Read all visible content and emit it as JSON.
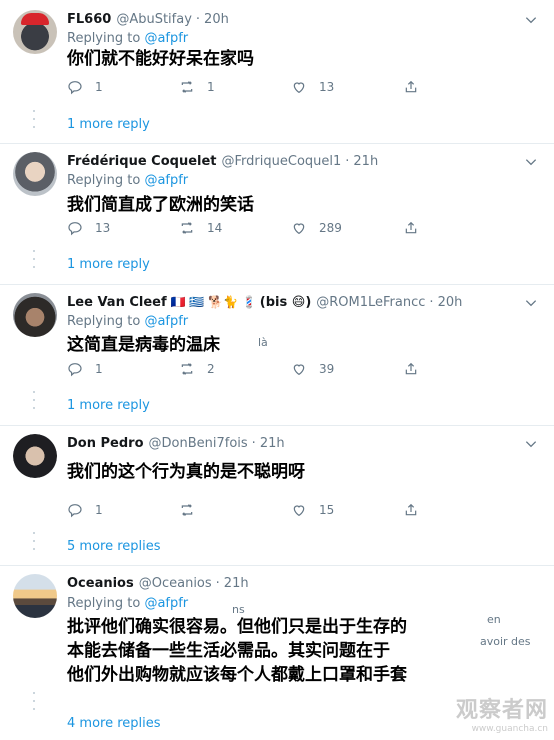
{
  "tweets": [
    {
      "name": "FL660",
      "handle": "@AbuStifay",
      "time": "20h",
      "replying_prefix": "Replying to",
      "replying_to": "@afpfr",
      "text_lines": [
        "你们就不能好好呆在家吗"
      ],
      "ghost": [],
      "reply_count": "1",
      "retweet_count": "1",
      "like_count": "13",
      "more_replies": "1 more reply"
    },
    {
      "name": "Frédérique Coquelet",
      "handle": "@FrdriqueCoquel1",
      "time": "21h",
      "replying_prefix": "Replying to",
      "replying_to": "@afpfr",
      "text_lines": [
        "我们简直成了欧洲的笑话"
      ],
      "ghost": [],
      "reply_count": "13",
      "retweet_count": "14",
      "like_count": "289",
      "more_replies": "1 more reply"
    },
    {
      "name": "Lee Van Cleef",
      "name_emojis": "🇫🇷 🇬🇷 🐕🐈 💈",
      "name_suffix": "(bis 😄)",
      "handle": "@ROM1LeFrancc",
      "time": "20h",
      "replying_prefix": "Replying to",
      "replying_to": "@afpfr",
      "text_lines": [
        "这简直是病毒的温床"
      ],
      "ghost": [
        "là"
      ],
      "reply_count": "1",
      "retweet_count": "2",
      "like_count": "39",
      "more_replies": "1 more reply"
    },
    {
      "name": "Don Pedro",
      "handle": "@DonBeni7fois",
      "time": "21h",
      "replying_prefix": "",
      "replying_to": "",
      "text_lines": [
        "我们的这个行为真的是不聪明呀"
      ],
      "ghost": [],
      "reply_count": "1",
      "retweet_count": "",
      "like_count": "15",
      "more_replies": "5 more replies"
    },
    {
      "name": "Oceanios",
      "handle": "@Oceanios",
      "time": "21h",
      "replying_prefix": "Replying to",
      "replying_to": "@afpfr",
      "text_lines": [
        "批评他们确实很容易。但他们只是出于生存的",
        "本能去储备一些生活必需品。其实问题在于",
        "他们外出购物就应该每个人都戴上口罩和手套"
      ],
      "ghost": [
        "ns",
        "en",
        "avoir des"
      ],
      "reply_count": "",
      "retweet_count": "",
      "like_count": "",
      "more_replies": "4 more replies"
    }
  ],
  "watermark": {
    "text": "观察者网",
    "url": "www.guancha.cn"
  },
  "icons": [
    "reply-icon",
    "retweet-icon",
    "like-icon",
    "share-icon",
    "chevron-down-icon"
  ],
  "colors": {
    "link": "#1b95e0",
    "secondary": "#657786",
    "separator": "#e6ecf0"
  }
}
